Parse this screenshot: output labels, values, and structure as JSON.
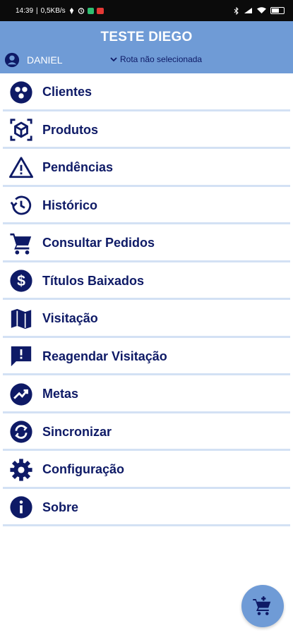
{
  "status_bar": {
    "time": "14:39",
    "network_speed": "0,5KB/s",
    "icons": [
      "pin-icon",
      "alarm-icon",
      "app-green-icon",
      "app-red-icon",
      "bluetooth-icon",
      "signal-icon",
      "wifi-icon",
      "battery-icon"
    ]
  },
  "header": {
    "title": "TESTE DIEGO",
    "user_name": "DANIEL",
    "route_label": "Rota não selecionada"
  },
  "colors": {
    "header_bg": "#6f9bd6",
    "accent_dark": "#0e1a66",
    "divider": "#d3e1f4"
  },
  "menu": {
    "items": [
      {
        "label": "Clientes",
        "icon": "clients-icon"
      },
      {
        "label": "Produtos",
        "icon": "products-icon"
      },
      {
        "label": "Pendências",
        "icon": "warning-icon"
      },
      {
        "label": "Histórico",
        "icon": "history-icon"
      },
      {
        "label": "Consultar Pedidos",
        "icon": "cart-icon"
      },
      {
        "label": "Títulos Baixados",
        "icon": "dollar-icon"
      },
      {
        "label": "Visitação",
        "icon": "map-icon"
      },
      {
        "label": "Reagendar Visitação",
        "icon": "feedback-icon"
      },
      {
        "label": "Metas",
        "icon": "trending-icon"
      },
      {
        "label": "Sincronizar",
        "icon": "sync-icon"
      },
      {
        "label": "Configuração",
        "icon": "gear-icon"
      },
      {
        "label": "Sobre",
        "icon": "info-icon"
      }
    ]
  },
  "fab": {
    "icon": "add-cart-icon"
  }
}
